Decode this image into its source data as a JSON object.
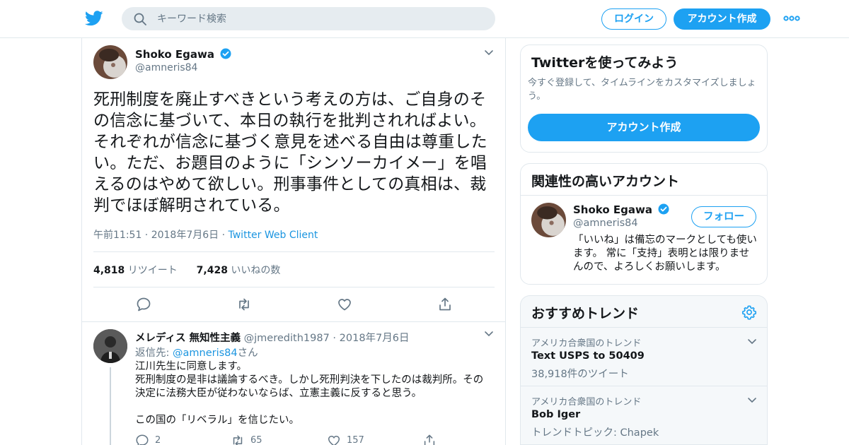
{
  "colors": {
    "accent": "#1da1f2",
    "link": "#1b95e0",
    "muted": "#657786",
    "border": "#e1e8ed",
    "text": "#14171a"
  },
  "header": {
    "logo_icon": "twitter-bird-icon",
    "search_placeholder": "キーワード検索",
    "login_label": "ログイン",
    "signup_label": "アカウント作成",
    "more_icon": "more-dots-icon"
  },
  "tweet": {
    "author_name": "Shoko Egawa",
    "author_handle": "@amneris84",
    "text": "死刑制度を廃止すべきという考えの方は、ご自身のその信念に基づいて、本日の執行を批判されればよい。それぞれが信念に基づく意見を述べる自由は尊重したい。ただ、お題目のように「シンソーカイメー」を唱えるのはやめて欲しい。刑事事件としての真相は、裁判でほぼ解明されている。",
    "time": "午前11:51 · 2018年7月6日",
    "separator": "·",
    "client": "Twitter Web Client",
    "retweet_count": "4,818",
    "retweet_label": "リツイート",
    "like_count": "7,428",
    "like_label": "いいねの数"
  },
  "reply": {
    "author_name": "メレディス 無知性主義",
    "author_handle": "@jmeredith1987",
    "date": "2018年7月6日",
    "replying_prefix": "返信先: ",
    "replying_to": "@amneris84",
    "replying_suffix": "さん",
    "lines": [
      "江川先生に同意します。",
      "死刑制度の是非は議論するべき。しかし死刑判決を下したのは裁判所。その決定に法務大臣が従わないならば、立憲主義に反すると思う。",
      "",
      "この国の「リベラル」を信じたい。"
    ],
    "reply_count": "2",
    "retweet_count": "65",
    "like_count": "157"
  },
  "sidebar": {
    "signup_card": {
      "title": "Twitterを使ってみよう",
      "subtitle": "今すぐ登録して、タイムラインをカスタマイズしましょう。",
      "button": "アカウント作成"
    },
    "relevant": {
      "title": "関連性の高いアカウント",
      "name": "Shoko Egawa",
      "handle": "@amneris84",
      "follow_label": "フォロー",
      "bio": "「いいね」は備忘のマークとしても使います。 常に「支持」表明とは限りませんので、よろしくお願いします。"
    },
    "trends": {
      "title": "おすすめトレンド",
      "items": [
        {
          "context": "アメリカ合衆国のトレンド",
          "name": "Text USPS to 50409",
          "meta": "38,918件のツイート"
        },
        {
          "context": "アメリカ合衆国のトレンド",
          "name": "Bob Iger",
          "meta": "トレンドトピック: Chapek"
        }
      ]
    }
  }
}
